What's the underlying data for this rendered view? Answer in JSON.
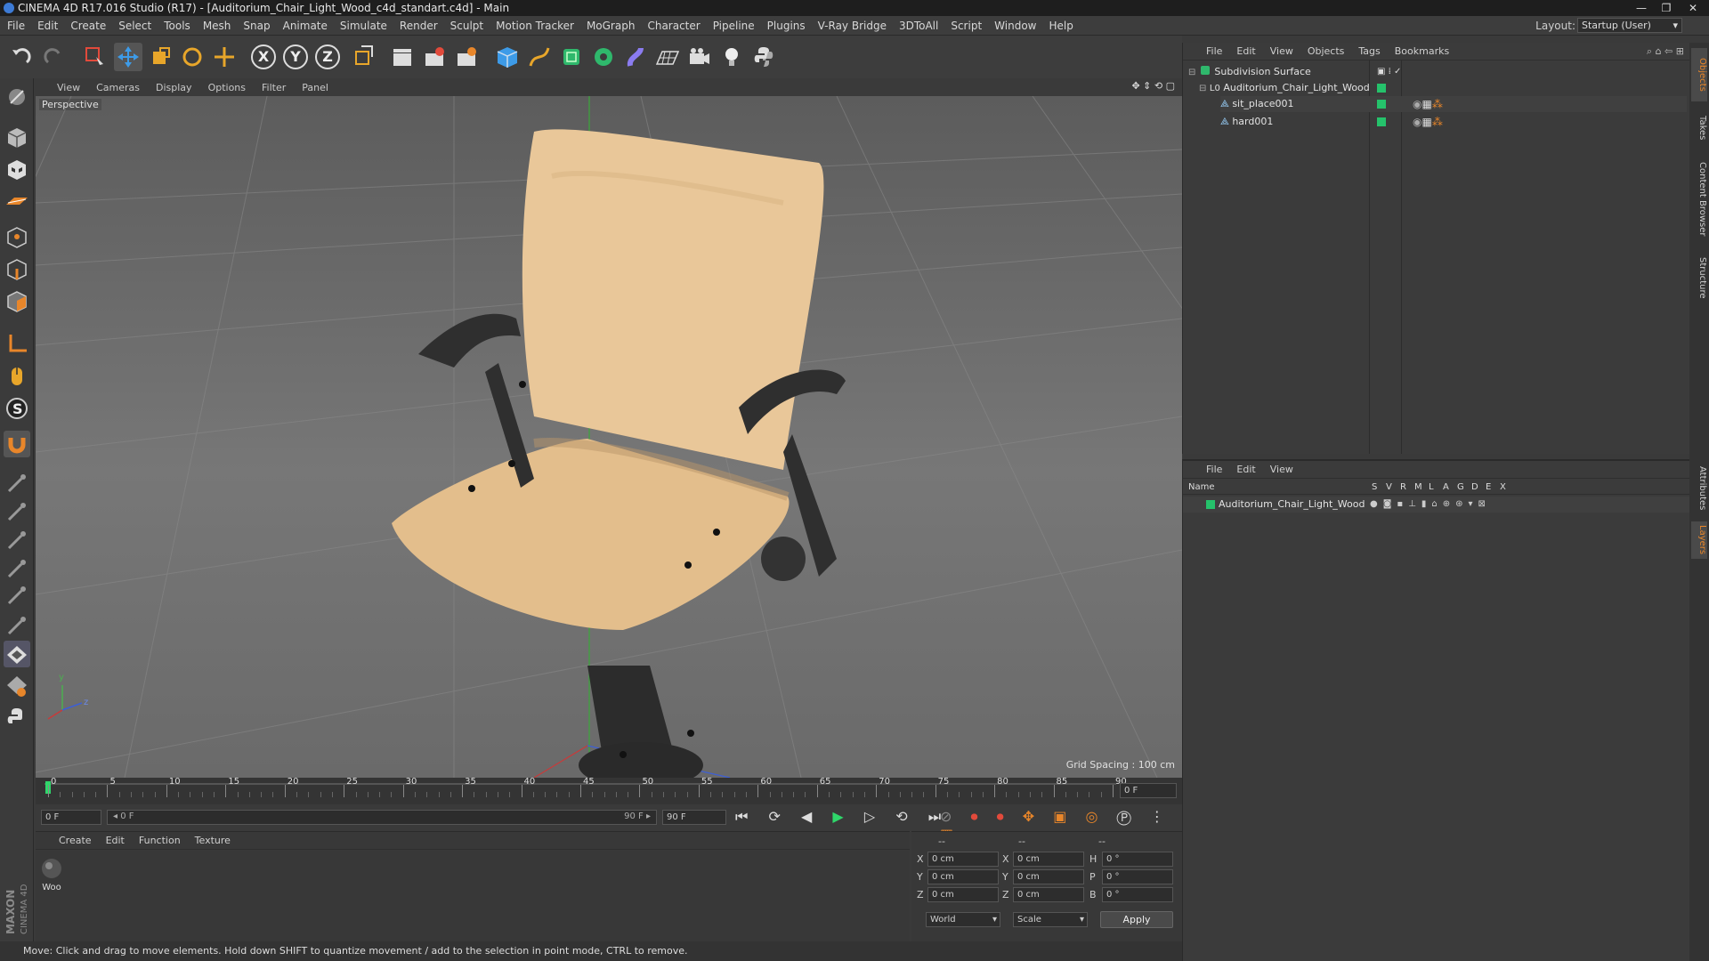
{
  "window": {
    "title": "CINEMA 4D R17.016 Studio (R17) - [Auditorium_Chair_Light_Wood_c4d_standart.c4d] - Main",
    "controls": [
      "—",
      "❐",
      "✕"
    ]
  },
  "menubar": {
    "items": [
      "File",
      "Edit",
      "Create",
      "Select",
      "Tools",
      "Mesh",
      "Snap",
      "Animate",
      "Simulate",
      "Render",
      "Sculpt",
      "Motion Tracker",
      "MoGraph",
      "Character",
      "Pipeline",
      "Plugins",
      "V-Ray Bridge",
      "3DToAll",
      "Script",
      "Window",
      "Help"
    ],
    "layout_label": "Layout:",
    "layout_value": "Startup (User)"
  },
  "toolbar": {
    "axis_labels": [
      "X",
      "Y",
      "Z"
    ]
  },
  "viewport": {
    "menu": [
      "View",
      "Cameras",
      "Display",
      "Options",
      "Filter",
      "Panel"
    ],
    "camera_label": "Perspective",
    "grid_spacing": "Grid Spacing : 100 cm",
    "axis_labels": {
      "y": "y",
      "z": "z"
    }
  },
  "timeline": {
    "ticks": [
      "0",
      "5",
      "10",
      "15",
      "20",
      "25",
      "30",
      "35",
      "40",
      "45",
      "50",
      "55",
      "60",
      "65",
      "70",
      "75",
      "80",
      "85",
      "90"
    ],
    "current_frame": "0 F"
  },
  "transport": {
    "start_field": "0 F",
    "range_start": "◂ 0 F",
    "range_end": "90 F ▸",
    "end_field": "90 F"
  },
  "material_manager": {
    "menu": [
      "Create",
      "Edit",
      "Function",
      "Texture"
    ],
    "materials": [
      {
        "name": "Woo"
      }
    ]
  },
  "coordinates": {
    "headers": [
      "--",
      "--",
      "--"
    ],
    "rows": [
      {
        "pos_label": "X",
        "pos": "0 cm",
        "size_label": "X",
        "size": "0 cm",
        "rot_label": "H",
        "rot": "0 °"
      },
      {
        "pos_label": "Y",
        "pos": "0 cm",
        "size_label": "Y",
        "size": "0 cm",
        "rot_label": "P",
        "rot": "0 °"
      },
      {
        "pos_label": "Z",
        "pos": "0 cm",
        "size_label": "Z",
        "size": "0 cm",
        "rot_label": "B",
        "rot": "0 °"
      }
    ],
    "coord_system": "World",
    "mode": "Scale",
    "apply_label": "Apply"
  },
  "statusbar": {
    "text": "Move: Click and drag to move elements. Hold down SHIFT to quantize movement / add to the selection in point mode, CTRL to remove."
  },
  "object_manager": {
    "menu": [
      "File",
      "Edit",
      "View",
      "Objects",
      "Tags",
      "Bookmarks"
    ],
    "objects": [
      {
        "name": "Subdivision Surface",
        "level": 0
      },
      {
        "name": "Auditorium_Chair_Light_Wood",
        "level": 1
      },
      {
        "name": "sit_place001",
        "level": 2
      },
      {
        "name": "hard001",
        "level": 2
      }
    ]
  },
  "layer_manager": {
    "menu": [
      "File",
      "Edit",
      "View"
    ],
    "columns": [
      "Name",
      "S",
      "V",
      "R",
      "M",
      "L",
      "A",
      "G",
      "D",
      "E",
      "X"
    ],
    "layers": [
      {
        "name": "Auditorium_Chair_Light_Wood"
      }
    ]
  },
  "right_tabs": [
    "Objects",
    "Takes",
    "Content Browser",
    "Structure",
    "Attributes",
    "Layers"
  ],
  "branding": {
    "line1": "MAXON",
    "line2": "CINEMA 4D"
  },
  "colors": {
    "accent_orange": "#e8862a",
    "layer_green": "#25c26b",
    "axis_blue": "#3d7bd6"
  }
}
